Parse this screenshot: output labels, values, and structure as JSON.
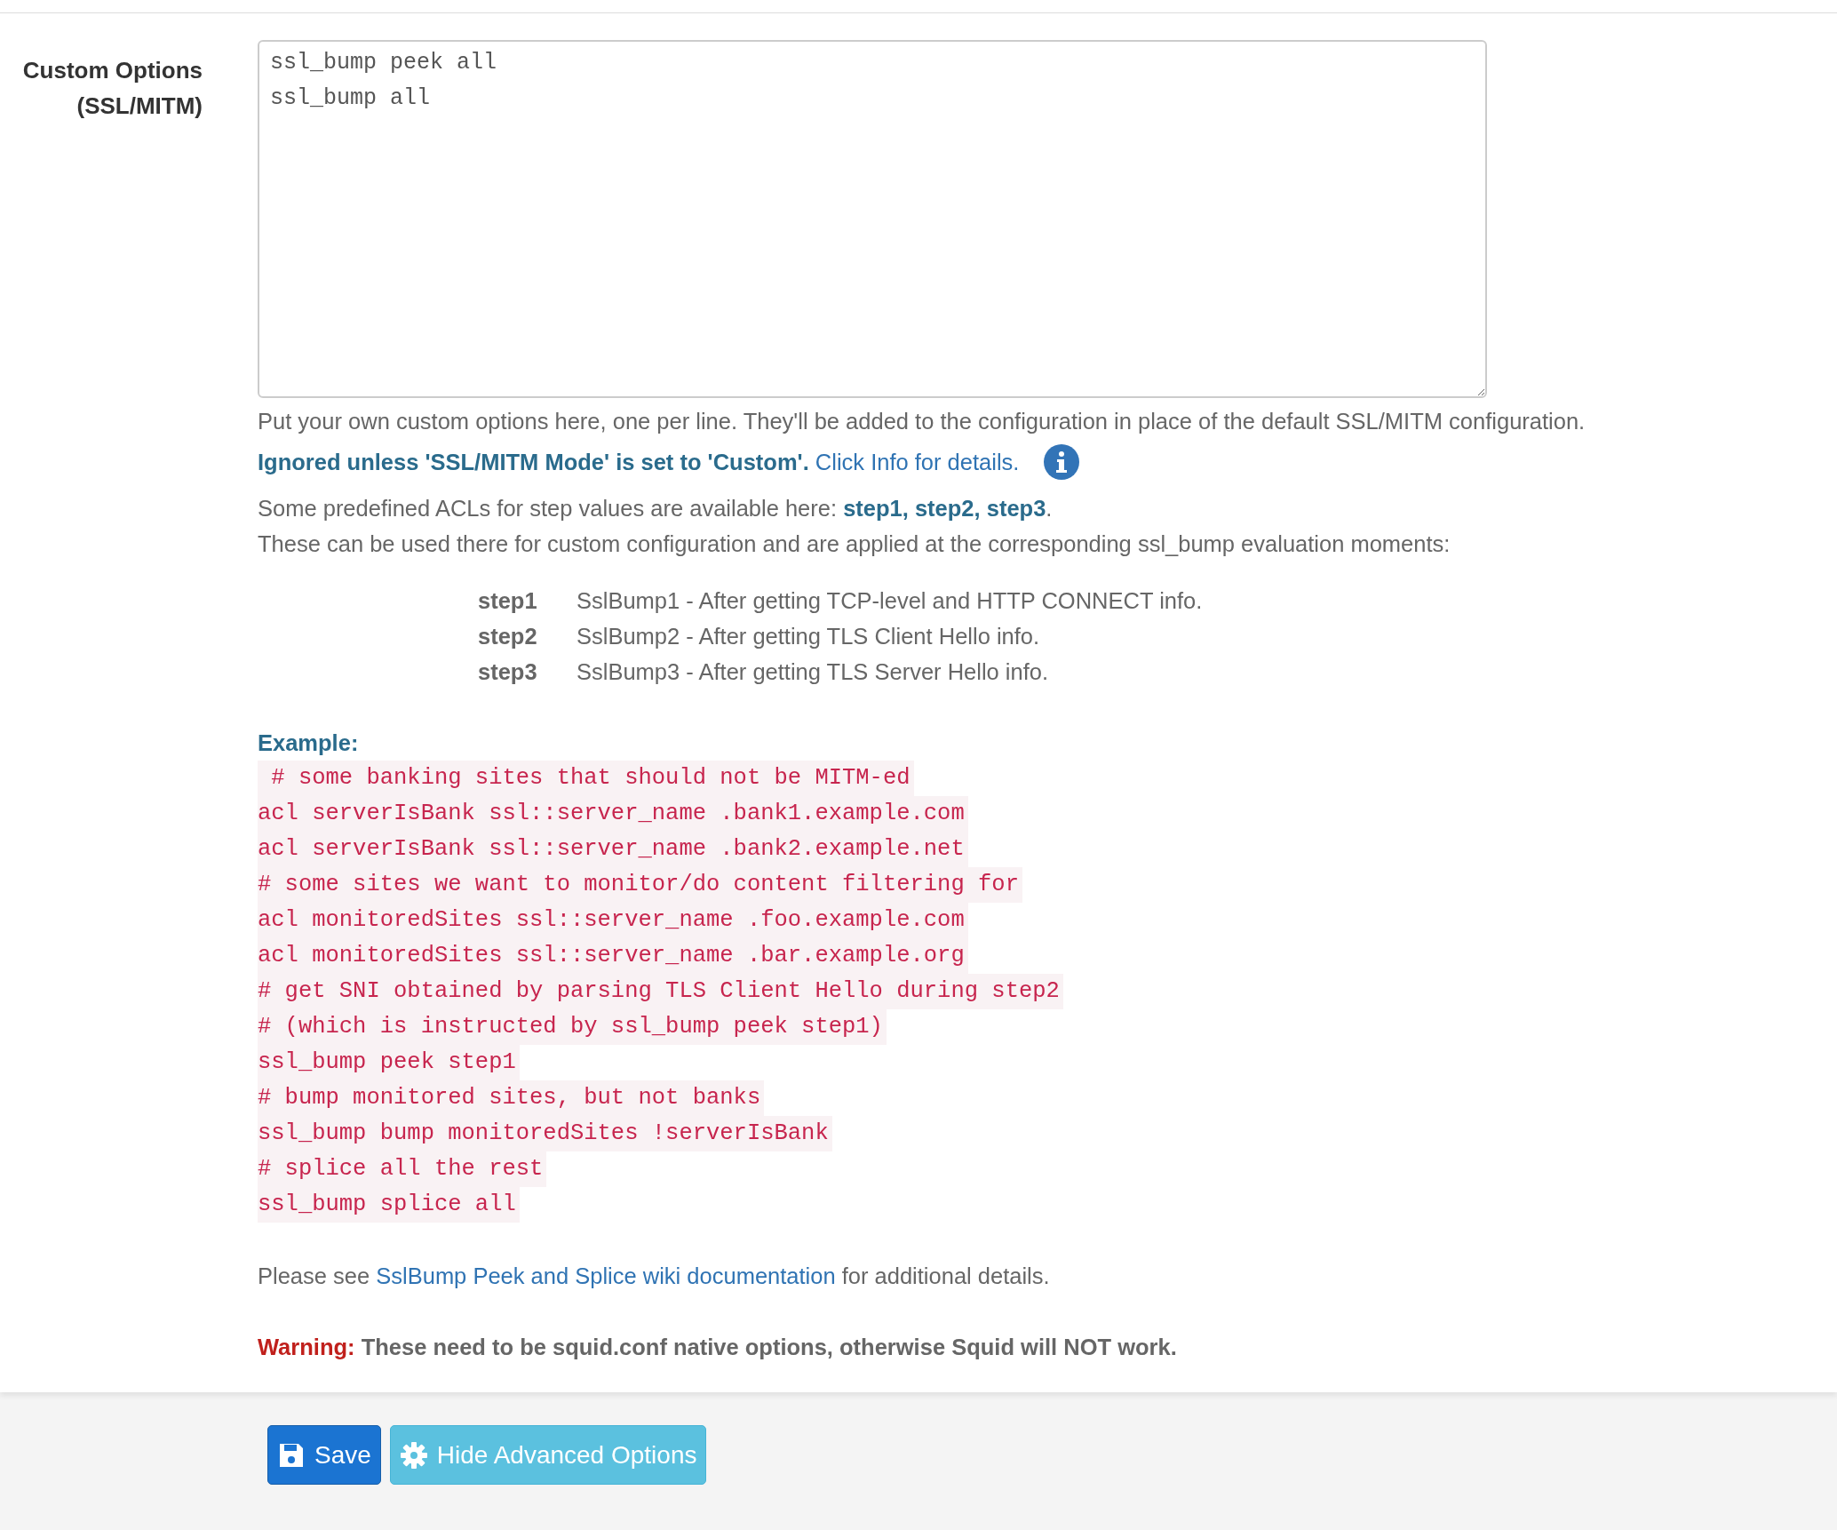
{
  "field": {
    "label": "Custom Options (SSL/MITM)",
    "value": "ssl_bump peek all\nssl_bump all"
  },
  "help": {
    "intro": "Put your own custom options here, one per line. They'll be added to the configuration in place of the default SSL/MITM configuration.",
    "note": {
      "bold": "Ignored unless 'SSL/MITM Mode' is set to 'Custom'.",
      "link": "Click Info for details."
    },
    "acls": "Some predefined ACLs for step values are available here: **step1, step2, step3**.",
    "usage": "These can be used there for custom configuration and are applied at the corresponding ssl_bump evaluation moments:",
    "steps": [
      {
        "term": "step1",
        "desc": "SslBump1 - After getting TCP-level and HTTP CONNECT info."
      },
      {
        "term": "step2",
        "desc": "SslBump2 - After getting TLS Client Hello info."
      },
      {
        "term": "step3",
        "desc": "SslBump3 - After getting TLS Server Hello info."
      }
    ],
    "example_heading": "Example:",
    "example_lines": [
      " # some banking sites that should not be MITM-ed",
      "acl serverIsBank ssl::server_name .bank1.example.com",
      "acl serverIsBank ssl::server_name .bank2.example.net",
      "# some sites we want to monitor/do content filtering for",
      "acl monitoredSites ssl::server_name .foo.example.com",
      "acl monitoredSites ssl::server_name .bar.example.org",
      "# get SNI obtained by parsing TLS Client Hello during step2",
      "# (which is instructed by ssl_bump peek step1)",
      "ssl_bump peek step1",
      "# bump monitored sites, but not banks",
      "ssl_bump bump monitoredSites !serverIsBank",
      "# splice all the rest",
      "ssl_bump splice all"
    ],
    "see": {
      "before": "Please see ",
      "link": "SslBump Peek and Splice wiki documentation",
      "after": " for additional details."
    },
    "warning": {
      "label": "Warning:",
      "text": "These need to be squid.conf native options, otherwise Squid will NOT work."
    }
  },
  "buttons": [
    {
      "kind": "save",
      "label": "Save"
    },
    {
      "kind": "advanced",
      "label": "Hide Advanced Options"
    }
  ]
}
